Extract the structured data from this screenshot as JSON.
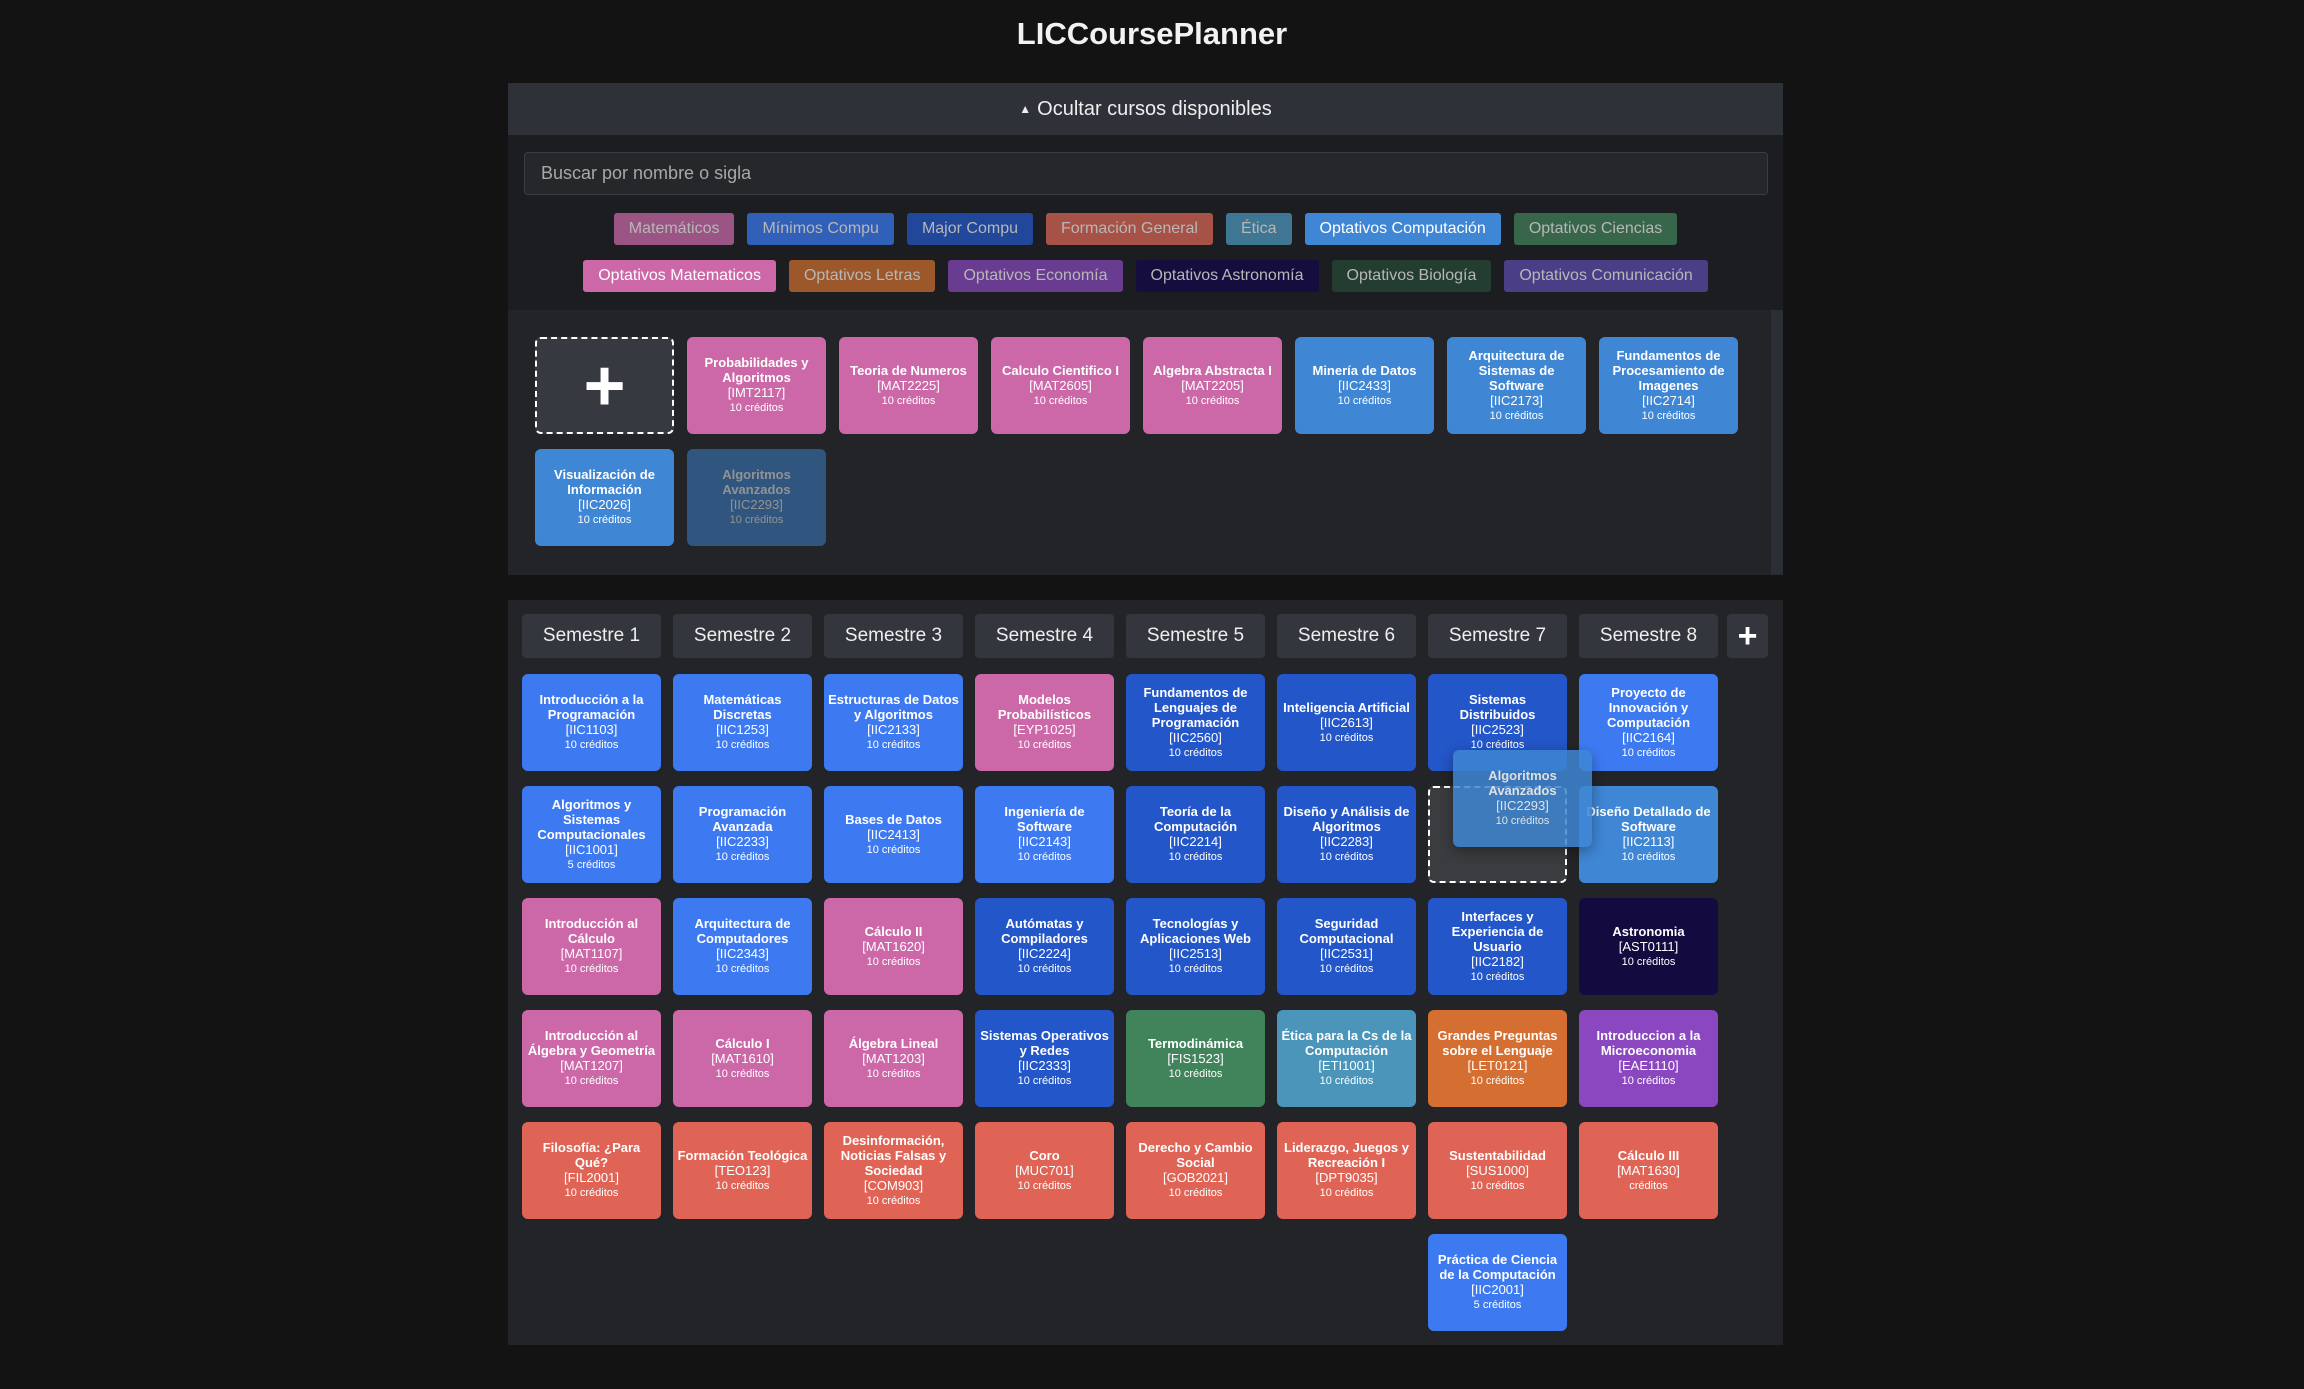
{
  "app": {
    "title": "LICCoursePlanner"
  },
  "toggle": {
    "icon": "triangle-up-icon",
    "label": "Ocultar cursos disponibles"
  },
  "search": {
    "placeholder": "Buscar por nombre o sigla",
    "value": ""
  },
  "colors": {
    "mat": "#cc68a8",
    "min": "#3d7af2",
    "maj": "#2356c8",
    "fg": "#e06456",
    "eti": "#4a95b9",
    "opc": "#3f86d4",
    "cie": "#41835b",
    "let": "#d56f31",
    "eco": "#8a47bf",
    "ast": "#130a40",
    "bio": "#233d30",
    "com": "#4a3f86"
  },
  "filters": [
    [
      {
        "label": "Matemáticos",
        "bg": "#9a5585",
        "active": false
      },
      {
        "label": "Mínimos Compu",
        "bg": "#3060b8",
        "active": false
      },
      {
        "label": "Major Compu",
        "bg": "#21479a",
        "active": false
      },
      {
        "label": "Formación General",
        "bg": "#a65247",
        "active": false
      },
      {
        "label": "Ética",
        "bg": "#3f7693",
        "active": false
      },
      {
        "label": "Optativos Computación",
        "bg": "#3f86d4",
        "active": true
      },
      {
        "label": "Optativos Ciencias",
        "bg": "#37664a",
        "active": false
      }
    ],
    [
      {
        "label": "Optativos Matematicos",
        "bg": "#cc68a8",
        "active": true
      },
      {
        "label": "Optativos Letras",
        "bg": "#9c582a",
        "active": false
      },
      {
        "label": "Optativos Economía",
        "bg": "#6a3c91",
        "active": false
      },
      {
        "label": "Optativos Astronomía",
        "bg": "#150d3e",
        "active": false
      },
      {
        "label": "Optativos Biología",
        "bg": "#233d30",
        "active": false
      },
      {
        "label": "Optativos Comunicación",
        "bg": "#4a3f86",
        "active": false
      }
    ]
  ],
  "available": {
    "add_label": "+",
    "courses": [
      {
        "name": "Probabilidades y Algoritmos",
        "code": "[IMT2117]",
        "credits": "10 créditos",
        "color": "mat"
      },
      {
        "name": "Teoria de Numeros",
        "code": "[MAT2225]",
        "credits": "10 créditos",
        "color": "mat"
      },
      {
        "name": "Calculo Cientifico I",
        "code": "[MAT2605]",
        "credits": "10 créditos",
        "color": "mat"
      },
      {
        "name": "Algebra Abstracta I",
        "code": "[MAT2205]",
        "credits": "10 créditos",
        "color": "mat"
      },
      {
        "name": "Minería de Datos",
        "code": "[IIC2433]",
        "credits": "10 créditos",
        "color": "opc"
      },
      {
        "name": "Arquitectura de Sistemas de Software",
        "code": "[IIC2173]",
        "credits": "10 créditos",
        "color": "opc"
      },
      {
        "name": "Fundamentos de Procesamiento de Imagenes",
        "code": "[IIC2714]",
        "credits": "10 créditos",
        "color": "opc"
      },
      {
        "name": "Visualización de Información",
        "code": "[IIC2026]",
        "credits": "10 créditos",
        "color": "opc"
      },
      {
        "name": "Algoritmos Avanzados",
        "code": "[IIC2293]",
        "credits": "10 créditos",
        "color": "opc",
        "dragging": true
      }
    ]
  },
  "semesters": [
    {
      "label": "Semestre 1",
      "courses": [
        {
          "name": "Introducción a la Programación",
          "code": "[IIC1103]",
          "credits": "10 créditos",
          "color": "min"
        },
        {
          "name": "Algoritmos y Sistemas Computacionales",
          "code": "[IIC1001]",
          "credits": "5 créditos",
          "color": "min"
        },
        {
          "name": "Introducción al Cálculo",
          "code": "[MAT1107]",
          "credits": "10 créditos",
          "color": "mat"
        },
        {
          "name": "Introducción al Álgebra y Geometría",
          "code": "[MAT1207]",
          "credits": "10 créditos",
          "color": "mat"
        },
        {
          "name": "Filosofía: ¿Para Qué?",
          "code": "[FIL2001]",
          "credits": "10 créditos",
          "color": "fg"
        }
      ]
    },
    {
      "label": "Semestre 2",
      "courses": [
        {
          "name": "Matemáticas Discretas",
          "code": "[IIC1253]",
          "credits": "10 créditos",
          "color": "min"
        },
        {
          "name": "Programación Avanzada",
          "code": "[IIC2233]",
          "credits": "10 créditos",
          "color": "min"
        },
        {
          "name": "Arquitectura de Computadores",
          "code": "[IIC2343]",
          "credits": "10 créditos",
          "color": "min"
        },
        {
          "name": "Cálculo I",
          "code": "[MAT1610]",
          "credits": "10 créditos",
          "color": "mat"
        },
        {
          "name": "Formación Teológica",
          "code": "[TEO123]",
          "credits": "10 créditos",
          "color": "fg"
        }
      ]
    },
    {
      "label": "Semestre 3",
      "courses": [
        {
          "name": "Estructuras de Datos y Algoritmos",
          "code": "[IIC2133]",
          "credits": "10 créditos",
          "color": "min"
        },
        {
          "name": "Bases de Datos",
          "code": "[IIC2413]",
          "credits": "10 créditos",
          "color": "min"
        },
        {
          "name": "Cálculo II",
          "code": "[MAT1620]",
          "credits": "10 créditos",
          "color": "mat"
        },
        {
          "name": "Álgebra Lineal",
          "code": "[MAT1203]",
          "credits": "10 créditos",
          "color": "mat"
        },
        {
          "name": "Desinformación, Noticias Falsas y Sociedad",
          "code": "[COM903]",
          "credits": "10 créditos",
          "color": "fg"
        }
      ]
    },
    {
      "label": "Semestre 4",
      "courses": [
        {
          "name": "Modelos Probabilísticos",
          "code": "[EYP1025]",
          "credits": "10 créditos",
          "color": "mat"
        },
        {
          "name": "Ingeniería de Software",
          "code": "[IIC2143]",
          "credits": "10 créditos",
          "color": "min"
        },
        {
          "name": "Autómatas y Compiladores",
          "code": "[IIC2224]",
          "credits": "10 créditos",
          "color": "maj"
        },
        {
          "name": "Sistemas Operativos y Redes",
          "code": "[IIC2333]",
          "credits": "10 créditos",
          "color": "maj"
        },
        {
          "name": "Coro",
          "code": "[MUC701]",
          "credits": "10 créditos",
          "color": "fg"
        }
      ]
    },
    {
      "label": "Semestre 5",
      "courses": [
        {
          "name": "Fundamentos de Lenguajes de Programación",
          "code": "[IIC2560]",
          "credits": "10 créditos",
          "color": "maj"
        },
        {
          "name": "Teoría de la Computación",
          "code": "[IIC2214]",
          "credits": "10 créditos",
          "color": "maj"
        },
        {
          "name": "Tecnologías y Aplicaciones Web",
          "code": "[IIC2513]",
          "credits": "10 créditos",
          "color": "maj"
        },
        {
          "name": "Termodinámica",
          "code": "[FIS1523]",
          "credits": "10 créditos",
          "color": "cie"
        },
        {
          "name": "Derecho y Cambio Social",
          "code": "[GOB2021]",
          "credits": "10 créditos",
          "color": "fg"
        }
      ]
    },
    {
      "label": "Semestre 6",
      "courses": [
        {
          "name": "Inteligencia Artificial",
          "code": "[IIC2613]",
          "credits": "10 créditos",
          "color": "maj"
        },
        {
          "name": "Diseño y Análisis de Algoritmos",
          "code": "[IIC2283]",
          "credits": "10 créditos",
          "color": "maj"
        },
        {
          "name": "Seguridad Computacional",
          "code": "[IIC2531]",
          "credits": "10 créditos",
          "color": "maj"
        },
        {
          "name": "Ética para la Cs de la Computación",
          "code": "[ETI1001]",
          "credits": "10 créditos",
          "color": "eti"
        },
        {
          "name": "Liderazgo, Juegos y Recreación I",
          "code": "[DPT9035]",
          "credits": "10 créditos",
          "color": "fg"
        }
      ]
    },
    {
      "label": "Semestre 7",
      "courses": [
        {
          "name": "Sistemas Distribuidos",
          "code": "[IIC2523]",
          "credits": "10 créditos",
          "color": "maj"
        },
        {
          "placeholder": true
        },
        {
          "name": "Interfaces y Experiencia de Usuario",
          "code": "[IIC2182]",
          "credits": "10 créditos",
          "color": "maj"
        },
        {
          "name": "Grandes Preguntas sobre el Lenguaje",
          "code": "[LET0121]",
          "credits": "10 créditos",
          "color": "let"
        },
        {
          "name": "Sustentabilidad",
          "code": "[SUS1000]",
          "credits": "10 créditos",
          "color": "fg"
        },
        {
          "name": "Práctica de Ciencia de la Computación",
          "code": "[IIC2001]",
          "credits": "5 créditos",
          "color": "min"
        }
      ]
    },
    {
      "label": "Semestre 8",
      "courses": [
        {
          "name": "Proyecto de Innovación y Computación",
          "code": "[IIC2164]",
          "credits": "10 créditos",
          "color": "min"
        },
        {
          "name": "Diseño Detallado de Software",
          "code": "[IIC2113]",
          "credits": "10 créditos",
          "color": "opc"
        },
        {
          "name": "Astronomia",
          "code": "[AST0111]",
          "credits": "10 créditos",
          "color": "ast"
        },
        {
          "name": "Introduccion a la Microeconomia",
          "code": "[EAE1110]",
          "credits": "10 créditos",
          "color": "eco"
        },
        {
          "name": "Cálculo III",
          "code": "[MAT1630]",
          "credits": "créditos",
          "color": "fg"
        }
      ]
    }
  ],
  "drag_ghost": {
    "name": "Algoritmos Avanzados",
    "code": "[IIC2293]",
    "credits": "10 créditos",
    "color": "opc"
  },
  "add_semester": {
    "icon": "plus-icon",
    "label": "+"
  }
}
